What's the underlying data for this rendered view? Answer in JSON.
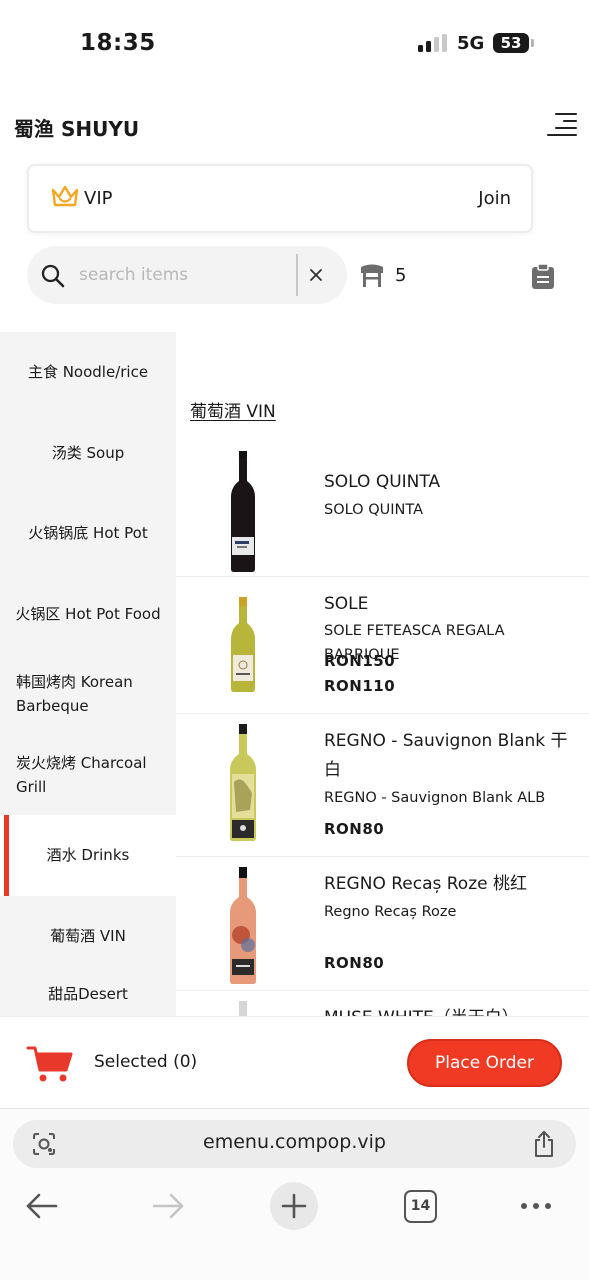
{
  "status_bar": {
    "time": "18:35",
    "network": "5G",
    "battery": "53"
  },
  "header": {
    "title": "蜀渔 SHUYU"
  },
  "vip": {
    "label": "VIP",
    "action": "Join"
  },
  "search": {
    "placeholder": "search items",
    "value": ""
  },
  "table": {
    "count": "5"
  },
  "sidebar": {
    "items": [
      {
        "label": "主食 Noodle/rice"
      },
      {
        "label": "汤类 Soup"
      },
      {
        "label": "火锅锅底 Hot Pot"
      },
      {
        "label": "火锅区 Hot Pot Food"
      },
      {
        "label": "韩国烤肉 Korean Barbeque"
      },
      {
        "label": "炭火烧烤 Charcoal Grill"
      },
      {
        "label": "酒水 Drinks"
      },
      {
        "label": "葡萄酒 VIN"
      },
      {
        "label": "甜品Desert"
      }
    ],
    "active": "酒水 Drinks"
  },
  "content": {
    "section_title": "葡萄酒 VIN",
    "products": [
      {
        "name": "SOLO QUINTA",
        "subtitle": "SOLO QUINTA",
        "price": "RON150"
      },
      {
        "name": "SOLE",
        "subtitle": "SOLE FETEASCA REGALA BARRIQUE",
        "price": "RON110"
      },
      {
        "name": "REGNO - Sauvignon Blank 干白",
        "subtitle": "REGNO - Sauvignon Blank ALB",
        "price": "RON80"
      },
      {
        "name": "REGNO Recaș Roze 桃红",
        "subtitle": "Regno Recaș Roze",
        "price": "RON80"
      },
      {
        "name": "MUSE WHITE（半干白）",
        "subtitle": "",
        "price": ""
      }
    ]
  },
  "cart": {
    "selected_label": "Selected (0)",
    "place_order": "Place Order"
  },
  "browser": {
    "url": "emenu.compop.vip",
    "tab_count": "14"
  },
  "colors": {
    "accent": "#f03a24",
    "active_bar": "#e8382b",
    "vip_crown": "#f5a623"
  }
}
